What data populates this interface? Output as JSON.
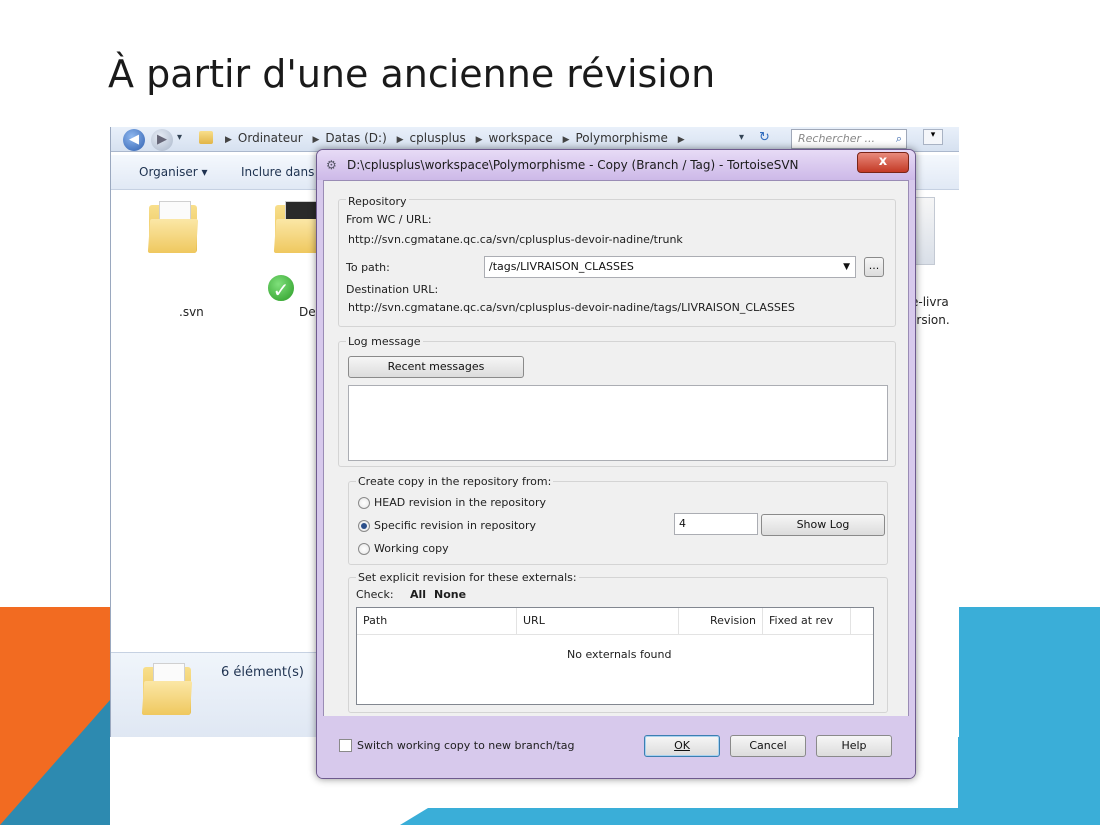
{
  "slide": {
    "title": "À partir d'une ancienne révision"
  },
  "explorer": {
    "breadcrumb": [
      "Ordinateur",
      "Datas (D:)",
      "cplusplus",
      "workspace",
      "Polymorphisme"
    ],
    "search_placeholder": "Rechercher ...",
    "toolbar": {
      "organize": "Organiser ▾",
      "include": "Inclure dans"
    },
    "files": [
      {
        "name": ".svn"
      },
      {
        "name": "De"
      }
    ],
    "right_file_label_1": "e-livra",
    "right_file_label_2": "ersion.",
    "status": "6 élément(s)"
  },
  "dialog": {
    "title": "D:\\cplusplus\\workspace\\Polymorphisme - Copy (Branch / Tag) - TortoiseSVN",
    "close_label": "x",
    "repository": {
      "group_label": "Repository",
      "from_label": "From WC / URL:",
      "from_url": "http://svn.cgmatane.qc.ca/svn/cplusplus-devoir-nadine/trunk",
      "to_path_label": "To path:",
      "to_path_value": "/tags/LIVRAISON_CLASSES",
      "browse_label": "...",
      "destination_label": "Destination URL:",
      "destination_url": "http://svn.cgmatane.qc.ca/svn/cplusplus-devoir-nadine/tags/LIVRAISON_CLASSES"
    },
    "log": {
      "group_label": "Log message",
      "recent_button": "Recent messages",
      "message": ""
    },
    "copy_from": {
      "group_label": "Create copy in the repository from:",
      "options": [
        {
          "label": "HEAD revision in the repository",
          "selected": false
        },
        {
          "label": "Specific revision in repository",
          "selected": true
        },
        {
          "label": "Working copy",
          "selected": false
        }
      ],
      "revision_value": "4",
      "show_log_button": "Show Log"
    },
    "externals": {
      "group_label": "Set explicit revision for these externals:",
      "check_label": "Check:",
      "check_all": "All",
      "check_none": "None",
      "columns": [
        "Path",
        "URL",
        "Revision",
        "Fixed at rev"
      ],
      "empty_message": "No externals found"
    },
    "footer": {
      "switch_label": "Switch working copy to new branch/tag",
      "switch_checked": false,
      "ok": "OK",
      "cancel": "Cancel",
      "help": "Help"
    }
  }
}
